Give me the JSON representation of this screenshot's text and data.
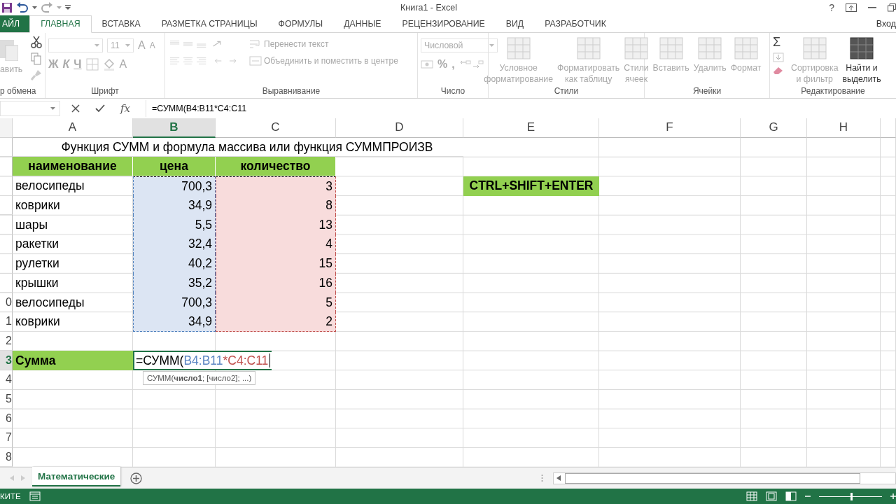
{
  "title_bar": {
    "title": "Книга1 - Excel",
    "help": "?"
  },
  "tabs": [
    {
      "label": "АЙЛ",
      "kind": "file",
      "selected": false
    },
    {
      "label": "ГЛАВНАЯ",
      "kind": "tab",
      "selected": true
    },
    {
      "label": "ВСТАВКА",
      "kind": "tab",
      "selected": false
    },
    {
      "label": "РАЗМЕТКА СТРАНИЦЫ",
      "kind": "tab",
      "selected": false
    },
    {
      "label": "ФОРМУЛЫ",
      "kind": "tab",
      "selected": false
    },
    {
      "label": "ДАННЫЕ",
      "kind": "tab",
      "selected": false
    },
    {
      "label": "РЕЦЕНЗИРОВАНИЕ",
      "kind": "tab",
      "selected": false
    },
    {
      "label": "ВИД",
      "kind": "tab",
      "selected": false
    },
    {
      "label": "РАЗРАБОТЧИК",
      "kind": "tab",
      "selected": false
    }
  ],
  "account": "Вход",
  "ribbon": [
    {
      "kind": "clipboard",
      "label": "р обмена",
      "paste": "авить"
    },
    {
      "kind": "font",
      "label": "Шрифт",
      "font_size": "11",
      "styles": [
        "Ж",
        "К",
        "Ч"
      ],
      "grow": "A",
      "shrink": "A",
      "font_color": "A"
    },
    {
      "kind": "alignment",
      "label": "Выравнивание",
      "wrap": "Перенести текст",
      "merge": "Объединить и поместить в центре"
    },
    {
      "kind": "number",
      "label": "Число",
      "format": "Числовой",
      "percent": "%",
      "thousands": ","
    },
    {
      "kind": "buttons",
      "label": "Стили",
      "buttons": [
        {
          "lines": [
            "Условное",
            "форматирование"
          ],
          "disabled": true
        },
        {
          "lines": [
            "Форматировать",
            "как таблицу"
          ],
          "disabled": true
        },
        {
          "lines": [
            "Стили",
            "ячеек"
          ],
          "disabled": true
        }
      ]
    },
    {
      "kind": "buttons",
      "label": "Ячейки",
      "buttons": [
        {
          "lines": [
            "Вставить"
          ],
          "disabled": true
        },
        {
          "lines": [
            "Удалить"
          ],
          "disabled": true
        },
        {
          "lines": [
            "Формат"
          ],
          "disabled": true
        }
      ]
    },
    {
      "kind": "editing",
      "label": "Редактирование",
      "sum": "Σ",
      "buttons": [
        {
          "lines": [
            "Сортировка",
            "и фильтр"
          ],
          "disabled": true
        },
        {
          "lines": [
            "Найти и",
            "выделить"
          ],
          "disabled": false
        }
      ]
    }
  ],
  "formula_bar": {
    "fx": "fx",
    "formula": "=СУММ(B4:B11*C4:C11"
  },
  "sheet": {
    "columns": [
      {
        "label": "A",
        "selected": false
      },
      {
        "label": "B",
        "selected": true
      },
      {
        "label": "C",
        "selected": false
      },
      {
        "label": "D",
        "selected": false
      },
      {
        "label": "E",
        "selected": false
      },
      {
        "label": "F",
        "selected": false
      },
      {
        "label": "G",
        "selected": false
      },
      {
        "label": "H",
        "selected": false
      }
    ],
    "rows": [
      {
        "kind": "title",
        "selected": false,
        "a": "Функция СУММ и формула массива или функция СУММПРОИЗВ"
      },
      {
        "kind": "header",
        "selected": false,
        "a": "наименование",
        "b": "цена",
        "c": "количество"
      },
      {
        "kind": "data",
        "selected": false,
        "a": "велосипеды",
        "b": "700,3",
        "c": "3",
        "e": "CTRL+SHIFT+ENTER"
      },
      {
        "kind": "data",
        "selected": false,
        "a": "коврики",
        "b": "34,9",
        "c": "8"
      },
      {
        "kind": "data",
        "selected": false,
        "a": "шары",
        "b": "5,5",
        "c": "13"
      },
      {
        "kind": "data",
        "selected": false,
        "a": "ракетки",
        "b": "32,4",
        "c": "4"
      },
      {
        "kind": "data",
        "selected": false,
        "a": "рулетки",
        "b": "40,2",
        "c": "15"
      },
      {
        "kind": "data",
        "selected": false,
        "a": "крышки",
        "b": "35,2",
        "c": "16"
      },
      {
        "kind": "data",
        "selected": false,
        "header": "0",
        "a": "велосипеды",
        "b": "700,3",
        "c": "5"
      },
      {
        "kind": "data",
        "selected": false,
        "header": "1",
        "a": "коврики",
        "b": "34,9",
        "c": "2"
      },
      {
        "kind": "empty",
        "selected": false,
        "header": "2"
      },
      {
        "kind": "sum",
        "selected": true,
        "header": "3",
        "a": "Сумма",
        "b": {
          "parts": [
            {
              "text": "=СУММ(",
              "color": "#000000"
            },
            {
              "text": "B4:B11",
              "color": "#5b85c2"
            },
            {
              "text": "*",
              "color": "#c0504d"
            },
            {
              "text": "C4:C11",
              "color": "#c0504d"
            }
          ],
          "tooltip": "СУММ(**число1**; [число2]; ...)"
        }
      },
      {
        "kind": "empty",
        "selected": false,
        "header": "4"
      },
      {
        "kind": "empty",
        "selected": false,
        "header": "5"
      },
      {
        "kind": "empty",
        "selected": false,
        "header": "6"
      },
      {
        "kind": "empty",
        "selected": false,
        "header": "7"
      },
      {
        "kind": "empty",
        "selected": false,
        "header": "8"
      }
    ]
  },
  "sheet_tabs": [
    {
      "label": "Математические",
      "selected": true
    }
  ],
  "status_bar": {
    "mode": "КИТЕ",
    "zoom": {
      "level": 0.5
    }
  }
}
